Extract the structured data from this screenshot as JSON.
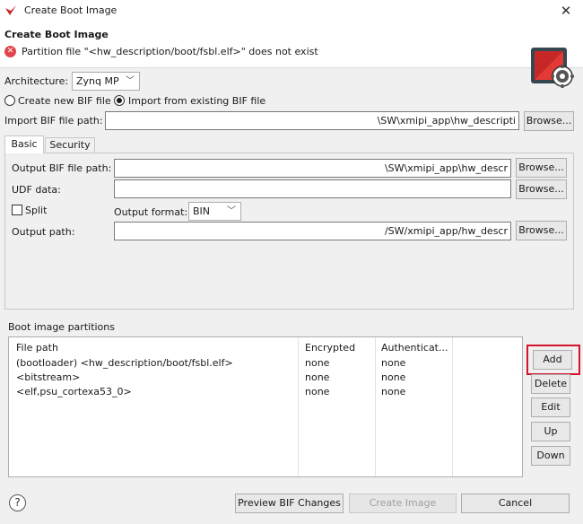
{
  "window": {
    "title": "Create Boot Image",
    "close_glyph": "✕"
  },
  "header": {
    "title": "Create Boot Image",
    "error_message": "Partition file \"<hw_description/boot/fsbl.elf>\" does not exist",
    "error_icon": "error-icon",
    "logo_icon": "gear-image-icon"
  },
  "architecture": {
    "label": "Architecture:",
    "value": "Zynq MP"
  },
  "bif_mode": {
    "create_label": "Create new BIF file",
    "import_label": "Import from existing BIF file",
    "selected": "import"
  },
  "import_bif": {
    "label": "Import BIF file path:",
    "value": "\\SW\\xmipi_app\\hw_descripti",
    "browse": "Browse..."
  },
  "tabs": [
    {
      "label": "Basic",
      "active": true
    },
    {
      "label": "Security",
      "active": false
    }
  ],
  "basic": {
    "output_bif_label": "Output BIF file path:",
    "output_bif_value": "\\SW\\xmipi_app\\hw_descr",
    "udf_label": "UDF data:",
    "udf_value": "",
    "split_label": "Split",
    "split_checked": false,
    "output_format_label": "Output format:",
    "output_format_value": "BIN",
    "output_path_label": "Output path:",
    "output_path_value": "/SW/xmipi_app/hw_descr",
    "browse": "Browse..."
  },
  "partitions": {
    "label": "Boot image partitions",
    "columns": [
      "File path",
      "Encrypted",
      "Authenticat..."
    ],
    "rows": [
      [
        "(bootloader) <hw_description/boot/fsbl.elf>",
        "none",
        "none"
      ],
      [
        "<bitstream>",
        "none",
        "none"
      ],
      [
        "<elf,psu_cortexa53_0>",
        "none",
        "none"
      ]
    ],
    "buttons": {
      "add": "Add",
      "delete": "Delete",
      "edit": "Edit",
      "up": "Up",
      "down": "Down"
    }
  },
  "footer": {
    "help_glyph": "?",
    "preview": "Preview BIF Changes",
    "create": "Create Image",
    "cancel": "Cancel"
  },
  "colors": {
    "highlight": "#d4122a",
    "error": "#e0474c",
    "logo_red": "#c62828",
    "logo_dark": "#37474f"
  }
}
